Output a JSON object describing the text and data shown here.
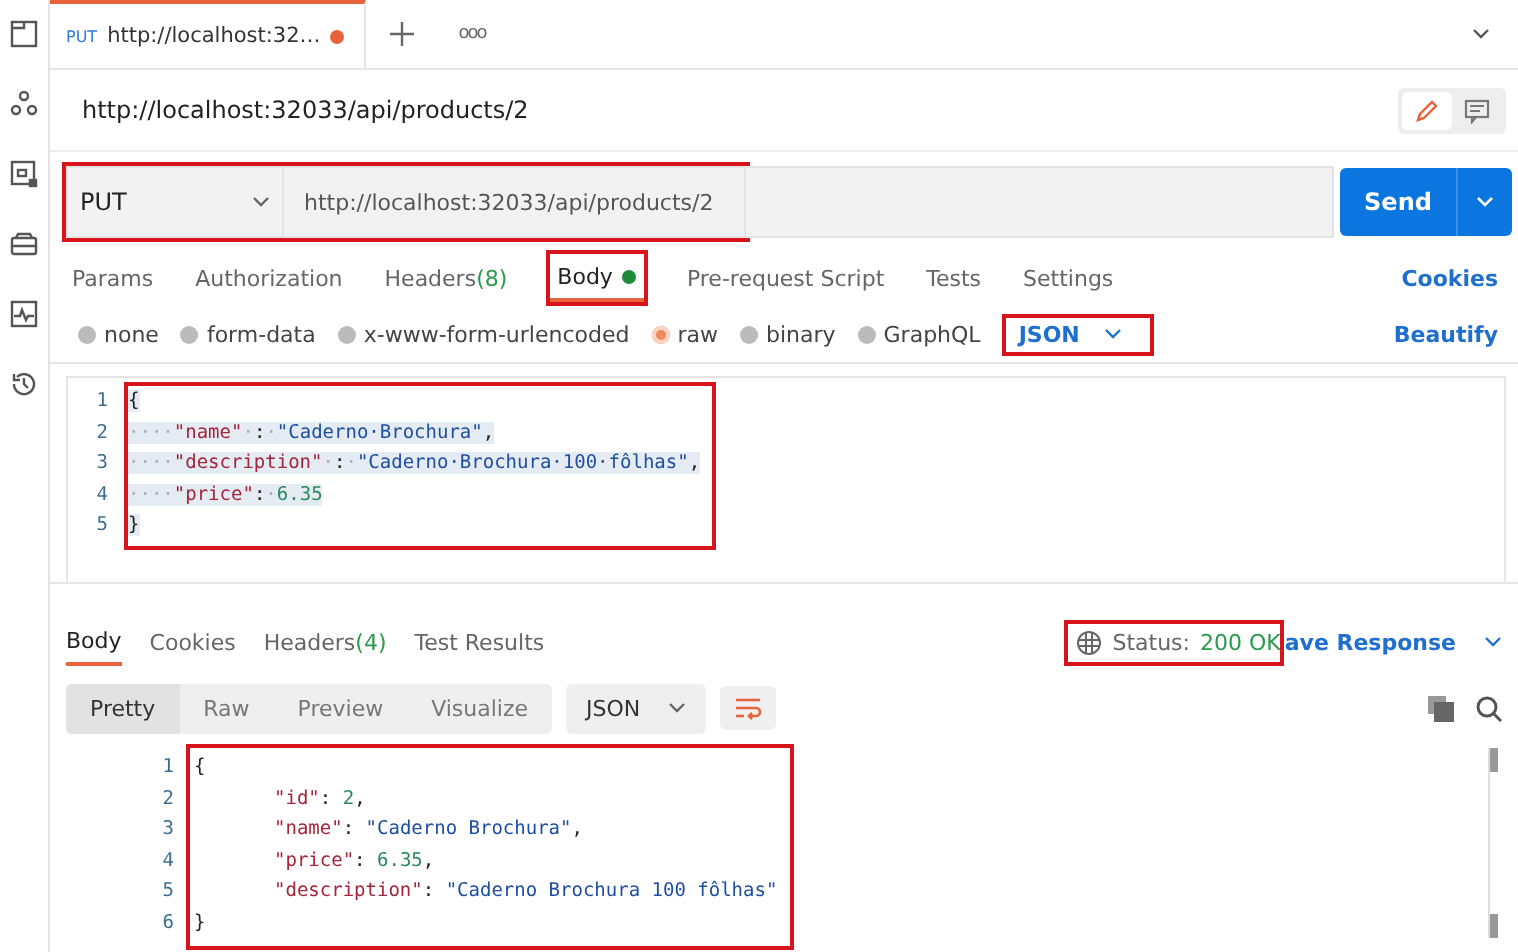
{
  "tabs": [
    {
      "method": "PUT",
      "title": "http://localhost:32…",
      "unsaved": true,
      "selected": true
    }
  ],
  "tab_bar": {
    "more": "ooo"
  },
  "request_title": "http://localhost:32033/api/products/2",
  "view_toggle": [
    {
      "selected": true
    },
    {
      "selected": false
    }
  ],
  "request": {
    "method": "PUT",
    "url": "http://localhost:32033/api/products/2",
    "highlighted": true,
    "send": "Send"
  },
  "request_tabs": [
    {
      "label": "Params",
      "selected": false
    },
    {
      "label": "Authorization",
      "selected": false
    },
    {
      "label": "Headers",
      "count": "(8)",
      "selected": false
    },
    {
      "label": "Body",
      "dot": true,
      "selected": true,
      "highlighted": true
    },
    {
      "label": "Pre-request Script",
      "selected": false
    },
    {
      "label": "Tests",
      "selected": false
    },
    {
      "label": "Settings",
      "selected": false
    }
  ],
  "cookies_link": "Cookies",
  "body_types": [
    {
      "label": "none",
      "selected": false
    },
    {
      "label": "form-data",
      "selected": false
    },
    {
      "label": "x-www-form-urlencoded",
      "selected": false
    },
    {
      "label": "raw",
      "selected": true
    },
    {
      "label": "binary",
      "selected": false
    },
    {
      "label": "GraphQL",
      "selected": false
    }
  ],
  "body_format": {
    "label": "JSON",
    "highlighted": true
  },
  "beautify": "Beautify",
  "request_body": {
    "highlighted": true,
    "lines": [
      {
        "number": "1",
        "tokens": [
          {
            "kind": "punct",
            "text": "{"
          }
        ]
      },
      {
        "number": "2",
        "tokens": [
          {
            "kind": "ws",
            "text": "····"
          },
          {
            "kind": "key",
            "text": "\"name\""
          },
          {
            "kind": "ws",
            "text": "·"
          },
          {
            "kind": "punct",
            "text": ":"
          },
          {
            "kind": "ws",
            "text": "·"
          },
          {
            "kind": "str",
            "text": "\"Caderno·Brochura\""
          },
          {
            "kind": "punct",
            "text": ","
          }
        ]
      },
      {
        "number": "3",
        "tokens": [
          {
            "kind": "ws",
            "text": "····"
          },
          {
            "kind": "key",
            "text": "\"description\""
          },
          {
            "kind": "ws",
            "text": "·"
          },
          {
            "kind": "punct",
            "text": ":"
          },
          {
            "kind": "ws",
            "text": "·"
          },
          {
            "kind": "str",
            "text": "\"Caderno·Brochura·100·fôlhas\""
          },
          {
            "kind": "punct",
            "text": ","
          }
        ]
      },
      {
        "number": "4",
        "tokens": [
          {
            "kind": "ws",
            "text": "····"
          },
          {
            "kind": "key",
            "text": "\"price\""
          },
          {
            "kind": "punct",
            "text": ":"
          },
          {
            "kind": "ws",
            "text": "·"
          },
          {
            "kind": "num",
            "text": "6.35"
          }
        ]
      },
      {
        "number": "5",
        "tokens": [
          {
            "kind": "punct",
            "text": "}"
          }
        ]
      }
    ]
  },
  "response_tabs": [
    {
      "label": "Body",
      "selected": true
    },
    {
      "label": "Cookies",
      "selected": false
    },
    {
      "label": "Headers",
      "count": "(4)",
      "selected": false
    },
    {
      "label": "Test Results",
      "selected": false
    }
  ],
  "status": {
    "label": "Status:",
    "value": "200 OK",
    "highlighted": true
  },
  "save_response": "ave Response",
  "view_modes": [
    {
      "label": "Pretty",
      "selected": true
    },
    {
      "label": "Raw",
      "selected": false
    },
    {
      "label": "Preview",
      "selected": false
    },
    {
      "label": "Visualize",
      "selected": false
    }
  ],
  "response_format": "JSON",
  "response_body": {
    "highlighted": true,
    "lines": [
      {
        "number": "1",
        "indented": false,
        "tokens": [
          {
            "kind": "punct",
            "text": "{"
          }
        ]
      },
      {
        "number": "2",
        "indented": true,
        "tokens": [
          {
            "kind": "key",
            "text": "\"id\""
          },
          {
            "kind": "punct",
            "text": ": "
          },
          {
            "kind": "num",
            "text": "2"
          },
          {
            "kind": "punct",
            "text": ","
          }
        ]
      },
      {
        "number": "3",
        "indented": true,
        "tokens": [
          {
            "kind": "key",
            "text": "\"name\""
          },
          {
            "kind": "punct",
            "text": ": "
          },
          {
            "kind": "str",
            "text": "\"Caderno Brochura\""
          },
          {
            "kind": "punct",
            "text": ","
          }
        ]
      },
      {
        "number": "4",
        "indented": true,
        "tokens": [
          {
            "kind": "key",
            "text": "\"price\""
          },
          {
            "kind": "punct",
            "text": ": "
          },
          {
            "kind": "num",
            "text": "6.35"
          },
          {
            "kind": "punct",
            "text": ","
          }
        ]
      },
      {
        "number": "5",
        "indented": true,
        "tokens": [
          {
            "kind": "key",
            "text": "\"description\""
          },
          {
            "kind": "punct",
            "text": ": "
          },
          {
            "kind": "str",
            "text": "\"Caderno Brochura 100 fôlhas\""
          }
        ]
      },
      {
        "number": "6",
        "indented": false,
        "tokens": [
          {
            "kind": "punct",
            "text": "}"
          }
        ]
      }
    ]
  }
}
